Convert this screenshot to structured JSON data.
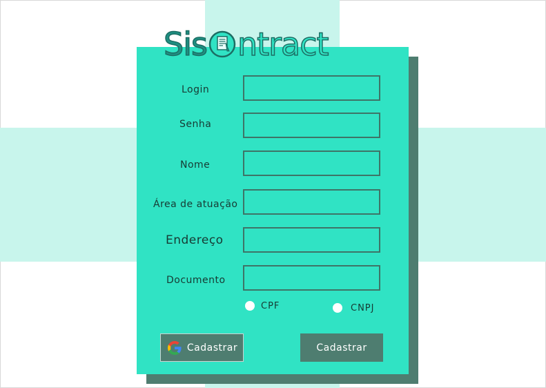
{
  "app": {
    "logo_text_left": "Sis",
    "logo_text_right": "ntract",
    "logo_icon": "document-in-circle-icon"
  },
  "form": {
    "fields": [
      {
        "label": "Login",
        "value": ""
      },
      {
        "label": "Senha",
        "value": ""
      },
      {
        "label": "Nome",
        "value": ""
      },
      {
        "label": "Área de atuação",
        "value": ""
      },
      {
        "label": "Endereço",
        "value": ""
      },
      {
        "label": "Documento",
        "value": ""
      }
    ],
    "document_type": {
      "options": [
        "CPF",
        "CNPJ"
      ],
      "selected": null
    }
  },
  "buttons": {
    "google_signup_label": "Cadastrar",
    "google_icon": "google-icon",
    "submit_label": "Cadastrar"
  },
  "colors": {
    "card": "#30e3c4",
    "shadow": "#4e7d70",
    "background_band": "#c8f5ec",
    "button": "#4e7d70"
  }
}
